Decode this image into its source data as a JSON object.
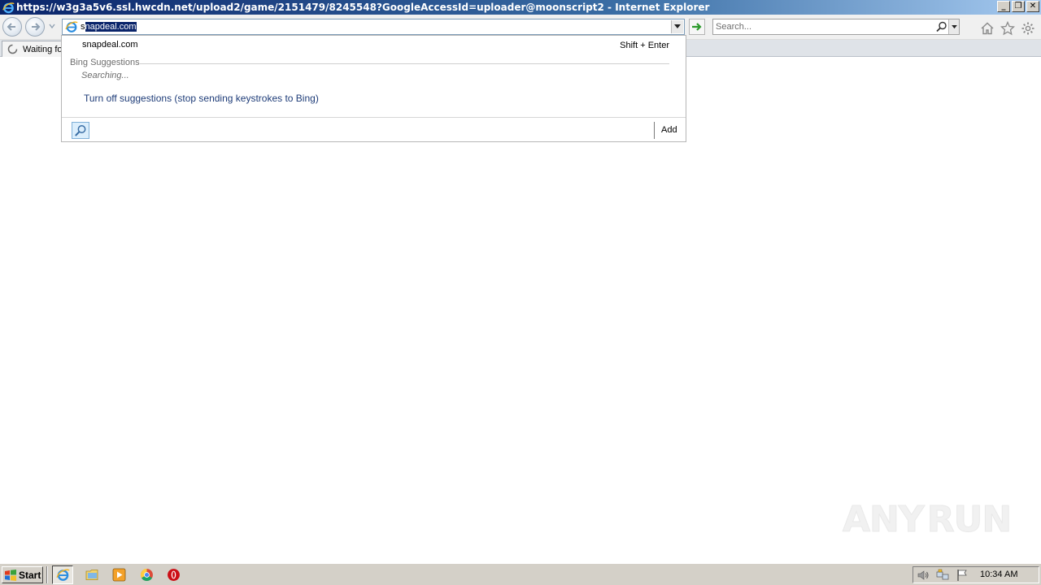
{
  "window": {
    "title": "https://w3g3a5v6.ssl.hwcdn.net/upload2/game/2151479/8245548?GoogleAccessId=uploader@moonscript2 - Internet Explorer",
    "buttons": {
      "minimize": "_",
      "restore": "❐",
      "close": "✕"
    }
  },
  "toolbar": {
    "address": {
      "typed": "s",
      "selected": "napdeal.com"
    },
    "search": {
      "placeholder": "Search..."
    }
  },
  "tab": {
    "label": "Waiting fo"
  },
  "autocomplete": {
    "suggestion": "snapdeal.com",
    "shortcut": "Shift + Enter",
    "bing_header": "Bing Suggestions",
    "searching": "Searching...",
    "turn_off": "Turn off suggestions (stop sending keystrokes to Bing)",
    "add_label": "Add"
  },
  "watermark": {
    "left": "ANY",
    "right": "RUN"
  },
  "taskbar": {
    "start_label": "Start",
    "clock": "10:34 AM"
  },
  "colors": {
    "titlebar_start": "#0a246a",
    "selection": "#0a246a",
    "link": "#1e3c78",
    "taskbar": "#d4d0c8"
  },
  "icons": [
    "ie-icon",
    "back-arrow-icon",
    "forward-arrow-icon",
    "go-arrow-icon",
    "search-icon",
    "home-icon",
    "star-icon",
    "gear-icon",
    "loading-spinner-icon",
    "windows-flag-icon",
    "folder-icon",
    "media-player-icon",
    "chrome-icon",
    "opera-icon",
    "speaker-icon",
    "network-icon",
    "flag-icon"
  ]
}
